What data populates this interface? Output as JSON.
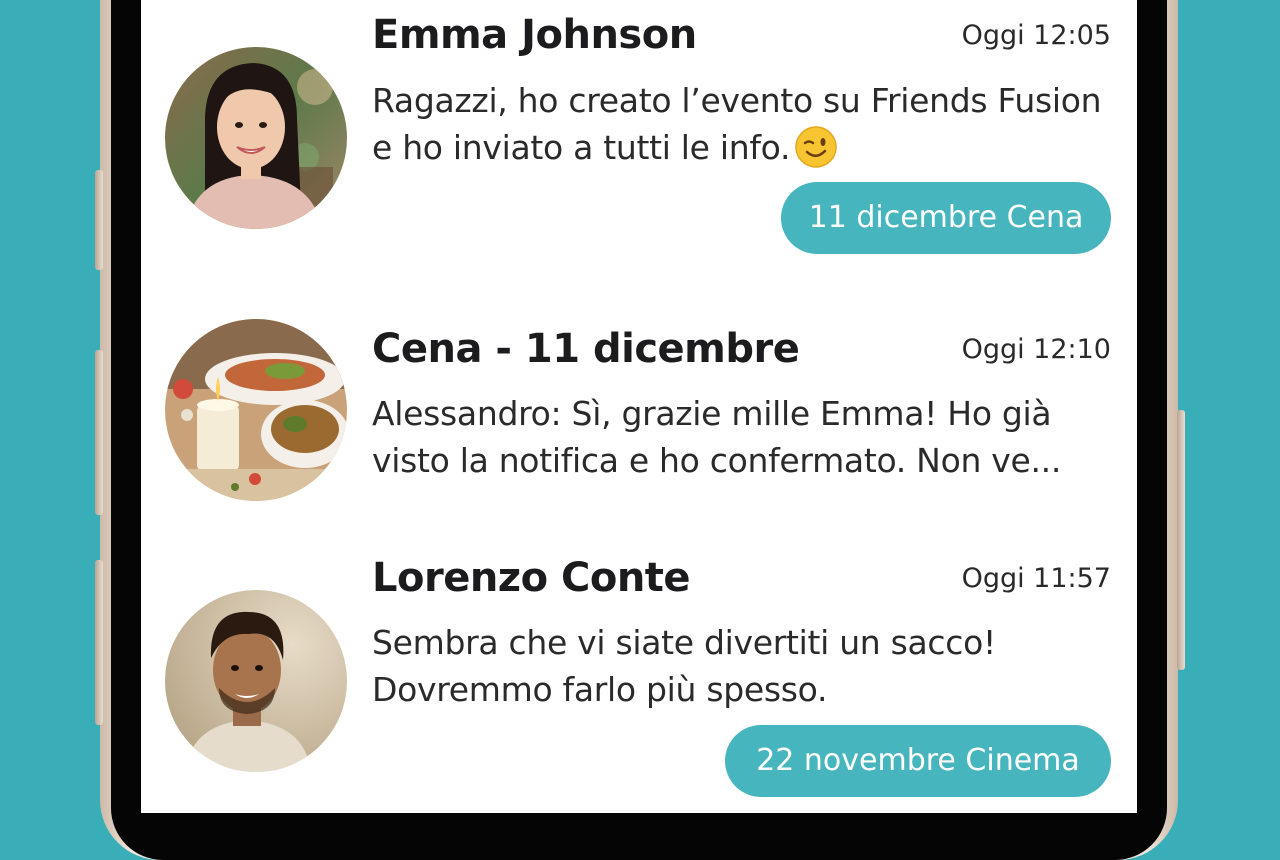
{
  "colors": {
    "background": "#3aaeb8",
    "pill": "#46b5bd",
    "screen": "#ffffff"
  },
  "chats": [
    {
      "name": "Emma Johnson",
      "time": "Oggi 12:05",
      "preview": "Ragazzi, ho creato l’evento su Friends Fusion e ho inviato a tutti le info.",
      "emoji": "winking-face-emoji",
      "event_tag": "11 dicembre Cena",
      "avatar": "woman-portrait-avatar"
    },
    {
      "name": "Cena - 11 dicembre",
      "time": "Oggi 12:10",
      "preview": "Alessandro: Sì, grazie mille Emma! Ho già visto la notifica e ho confermato. Non ve...",
      "avatar": "dinner-table-avatar"
    },
    {
      "name": "Lorenzo Conte",
      "time": "Oggi 11:57",
      "preview": "Sembra che vi siate divertiti un sacco! Dovremmo farlo più spesso.",
      "event_tag": "22 novembre Cinema",
      "avatar": "man-portrait-avatar"
    }
  ]
}
